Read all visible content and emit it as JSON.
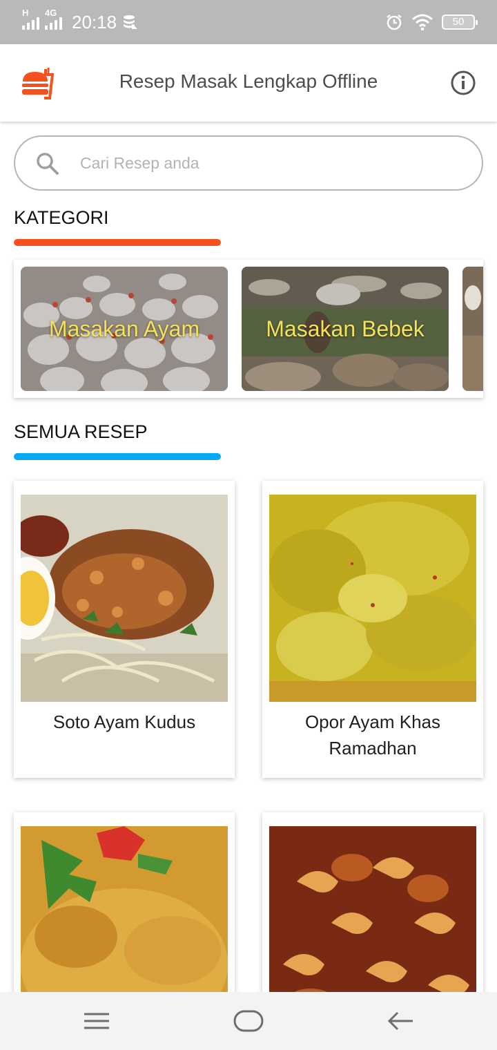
{
  "status_bar": {
    "network_1": "H",
    "network_2": "4G",
    "time": "20:18",
    "battery": "50"
  },
  "app_bar": {
    "title": "Resep Masak Lengkap Offline"
  },
  "search": {
    "placeholder": "Cari Resep anda"
  },
  "sections": {
    "categories_title": "KATEGORI",
    "all_recipes_title": "SEMUA RESEP"
  },
  "categories": [
    {
      "label": "Masakan Ayam"
    },
    {
      "label": "Masakan Bebek"
    }
  ],
  "recipes": [
    {
      "name": "Soto Ayam Kudus"
    },
    {
      "name": "Opor Ayam Khas Ramadhan"
    },
    {
      "name": ""
    },
    {
      "name": ""
    }
  ],
  "colors": {
    "accent_orange": "#f4511e",
    "accent_blue": "#03a9f4",
    "category_text": "#f7e15a"
  },
  "icons": {
    "logo": "burger-logo-icon",
    "info": "info-icon",
    "search": "search-icon",
    "nav_menu": "menu-icon",
    "nav_home": "home-icon",
    "nav_back": "back-arrow-icon"
  }
}
